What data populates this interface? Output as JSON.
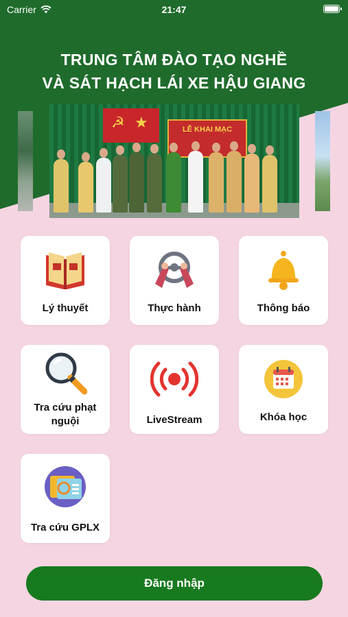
{
  "status_bar": {
    "carrier": "Carrier",
    "time": "21:47"
  },
  "header": {
    "title_line1": "TRUNG TÂM ĐÀO TẠO NGHỀ",
    "title_line2": "VÀ SÁT HẠCH LÁI XE HẬU GIANG"
  },
  "banner": {
    "heading": "LỄ KHAI MẠC"
  },
  "menu": [
    {
      "label": "Lý thuyết",
      "icon": "book-icon"
    },
    {
      "label": "Thực hành",
      "icon": "steering-wheel-icon"
    },
    {
      "label": "Thông báo",
      "icon": "bell-icon"
    },
    {
      "label": "Tra cứu phạt nguội",
      "icon": "magnifier-icon"
    },
    {
      "label": "LiveStream",
      "icon": "live-broadcast-icon"
    },
    {
      "label": "Khóa học",
      "icon": "calendar-icon"
    },
    {
      "label": "Tra cứu GPLX",
      "icon": "license-card-icon"
    }
  ],
  "login_label": "Đăng nhập",
  "colors": {
    "header_green": "#1f6b2c",
    "background_pink": "#f5d5e2",
    "button_green": "#187a1f"
  }
}
